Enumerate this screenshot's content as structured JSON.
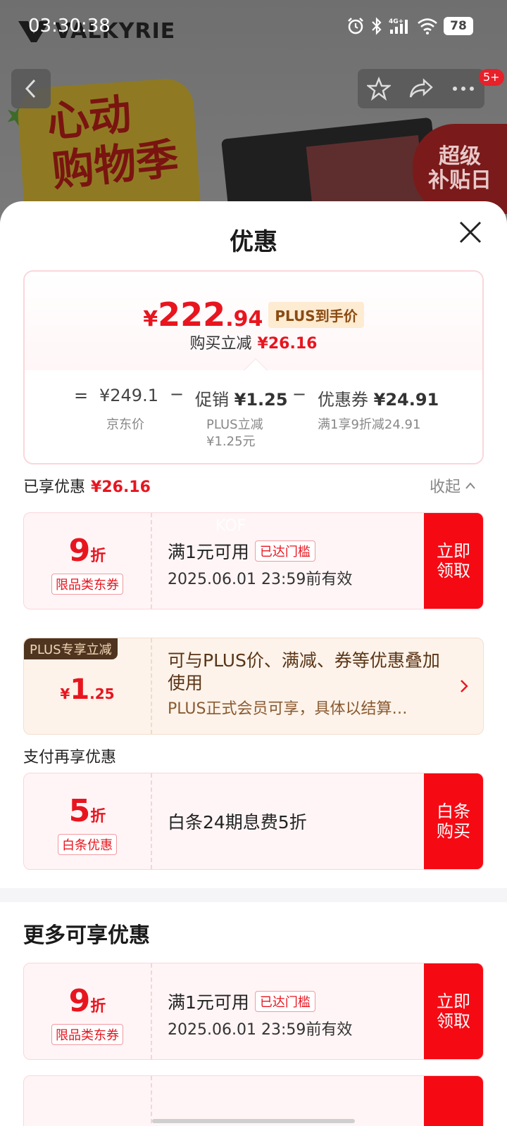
{
  "status_bar": {
    "time": "03:30:38",
    "network": "4G+",
    "battery": "78"
  },
  "background": {
    "brand": "VALKYRIE",
    "banner_text": "心动\n购物季",
    "side_banner": "超级\n补贴日",
    "badge": "5+"
  },
  "sheet": {
    "title": "优惠",
    "price": {
      "yen": "¥",
      "int": "222",
      "dec": ".94",
      "tag": "PLUS到手价",
      "sub_label": "购买立减",
      "sub_value": "¥26.16"
    },
    "breakdown": {
      "eq": "=",
      "jd_price": "¥249.1",
      "jd_label": "京东价",
      "minus1": "−",
      "promo_label": "促销",
      "promo_value": "¥1.25",
      "promo_desc1": "PLUS立减",
      "promo_desc2": "¥1.25元",
      "minus2": "−",
      "coupon_label": "优惠券",
      "coupon_value": "¥24.91",
      "coupon_desc": "满1享9折减24.91"
    },
    "enjoyed": {
      "label": "已享优惠",
      "value": "¥26.16",
      "collapse": "收起"
    },
    "coupon1": {
      "num": "9",
      "unit": "折",
      "tag": "限品类东券",
      "line1": "满1元可用",
      "reach": "已达门槛",
      "line2": "2025.06.01 23:59前有效",
      "action": "立即\n领取",
      "watermark": "KOF"
    },
    "plus_card": {
      "label": "PLUS专享立减",
      "yen": "¥",
      "int": "1",
      "dec": ".25",
      "text1": "可与PLUS价、满减、券等优惠叠加使用",
      "text2": "PLUS正式会员可享，具体以结算…"
    },
    "pay_section": {
      "label": "支付再享优惠"
    },
    "coupon2": {
      "num": "5",
      "unit": "折",
      "tag": "白条优惠",
      "line": "白条24期息费5折",
      "action": "白条\n购买"
    },
    "more": {
      "title": "更多可享优惠"
    },
    "coupon3": {
      "num": "9",
      "unit": "折",
      "tag": "限品类东券",
      "line1": "满1元可用",
      "reach": "已达门槛",
      "line2": "2025.06.01 23:59前有效",
      "action": "立即\n领取"
    }
  },
  "colors": {
    "accent_red": "#f50a14",
    "price_red": "#e8151f",
    "plus_brown": "#4f3420"
  }
}
